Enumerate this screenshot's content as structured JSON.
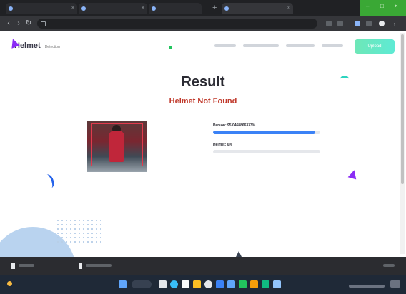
{
  "page": {
    "nav": {
      "brand": "Helmet",
      "brand_sub": "Detection",
      "cta_label": "Upload"
    },
    "result": {
      "title": "Result",
      "status": "Helmet Not Found"
    },
    "confidence": [
      {
        "label": "Person: 95.0468866333%",
        "fraction": 0.95
      },
      {
        "label": "Helmet: 0%",
        "fraction": 0
      }
    ]
  },
  "colors": {
    "status_red": "#c0392b",
    "progress_blue": "#3b82f6",
    "accent_green": "#6ee7b7",
    "deco_purple": "#8b2cf5"
  },
  "icons": {
    "tabs": "favicon-icon",
    "new_tab": "plus-icon",
    "back": "arrow-left-icon",
    "forward": "arrow-right-icon",
    "reload": "reload-icon",
    "lock": "lock-icon",
    "minimize": "minimize-icon",
    "maximize": "maximize-icon",
    "close": "close-icon",
    "file": "file-icon",
    "weather": "weather-icon",
    "start": "windows-start-icon",
    "search": "search-icon"
  }
}
